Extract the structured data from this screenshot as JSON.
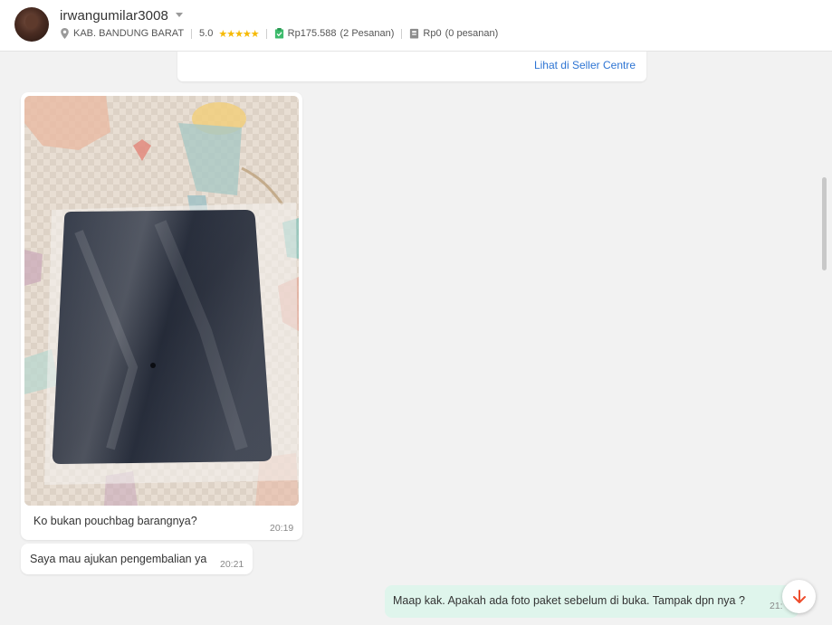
{
  "header": {
    "username": "irwangumilar3008",
    "location": "KAB. BANDUNG BARAT",
    "rating": "5.0",
    "rating_stars": 5,
    "completed_amount": "Rp175.588",
    "completed_orders": "(2 Pesanan)",
    "pending_amount": "Rp0",
    "pending_orders": "(0 pesanan)"
  },
  "top_card": {
    "link_label": "Lihat di Seller Centre"
  },
  "messages": [
    {
      "text": "Ko bukan pouchbag barangnya?",
      "time": "20:19"
    },
    {
      "text": "Saya mau ajukan pengembalian ya",
      "time": "20:21"
    },
    {
      "text": "Maap kak. Apakah ada foto paket sebelum di buka. Tampak dpn nya ?",
      "time": "21:"
    }
  ],
  "colors": {
    "link": "#2d74d3",
    "outgoing_bubble": "#dff5ec",
    "star": "#f6b900",
    "fab_arrow": "#ee4d2d"
  }
}
